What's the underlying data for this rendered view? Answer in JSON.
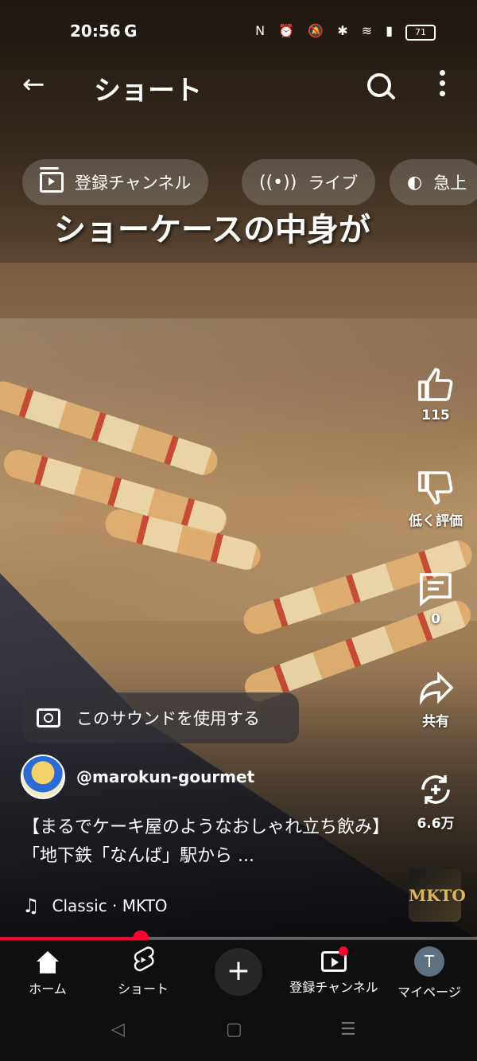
{
  "status_bar": {
    "time": "20:56",
    "g": "G",
    "icons": "N ⏰ 🔕 ✱ ≋ ▮",
    "battery": "71"
  },
  "topbar": {
    "back": "←",
    "title": "ショート"
  },
  "chips": [
    {
      "label": "登録チャンネル"
    },
    {
      "label": "ライブ"
    },
    {
      "label": "急上"
    }
  ],
  "video_caption": "ショーケースの中身が",
  "actions": {
    "like": "115",
    "dislike": "低く評価",
    "comments": "0",
    "share": "共有",
    "remix": "6.6万"
  },
  "sound_button": "このサウンドを使用する",
  "channel": {
    "handle": "@marokun-gourmet"
  },
  "description": "【まるでケーキ屋のようなおしゃれ立ち飲み】「地下鉄「なんば」駅から ...",
  "music": "Classic · MKTO",
  "album_art": "MKTO",
  "progress": 0.295,
  "nav": {
    "home": "ホーム",
    "shorts": "ショート",
    "create": "+",
    "subscriptions": "登録チャンネル",
    "mypage": "マイページ",
    "avatar_letter": "T"
  },
  "system_nav": {
    "back": "◁",
    "home": "▢",
    "recents": "☰"
  },
  "colors": {
    "accent": "#ff0033",
    "nav_bg": "#0f0f0f"
  }
}
